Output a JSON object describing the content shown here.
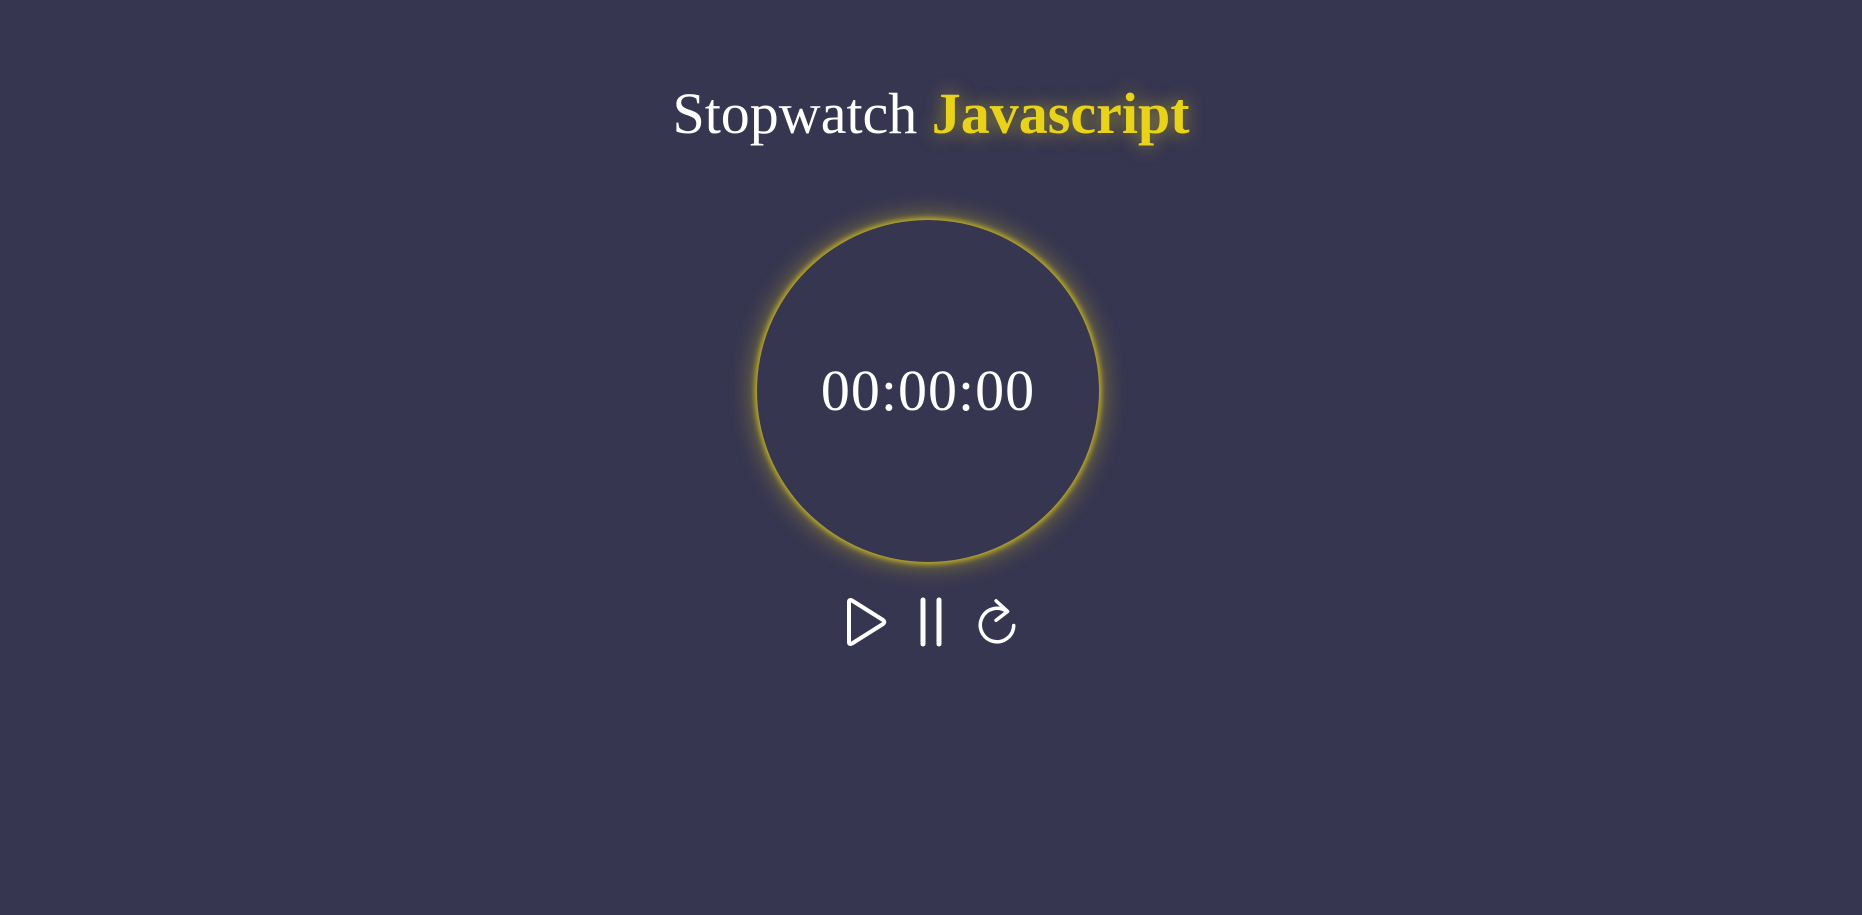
{
  "header": {
    "title_plain": "Stopwatch",
    "title_accent": "Javascript"
  },
  "stopwatch": {
    "display": "00:00:00"
  },
  "controls": [
    {
      "icon": "play-icon"
    },
    {
      "icon": "pause-icon"
    },
    {
      "icon": "reset-icon"
    }
  ],
  "colors": {
    "background": "#373651",
    "accent": "#e8d31a",
    "text": "#ffffff"
  }
}
